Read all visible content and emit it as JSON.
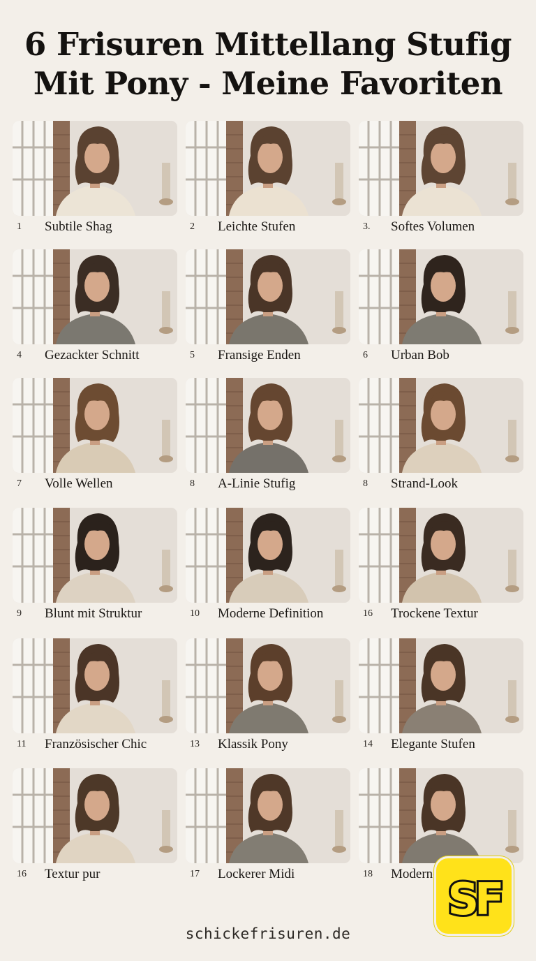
{
  "title": {
    "line1": "6 Frisuren Mittellang Stufig",
    "line2": "Mit Pony - Meine Favoriten"
  },
  "items": [
    {
      "number": "1",
      "label": "Subtile Shag",
      "top_color": "#ece4d6",
      "hair": "#5a4231"
    },
    {
      "number": "2",
      "label": "Leichte Stufen",
      "top_color": "#ebe1d1",
      "hair": "#5b4230"
    },
    {
      "number": "3.",
      "label": "Softes Volumen",
      "top_color": "#ebe2d3",
      "hair": "#5e4533"
    },
    {
      "number": "4",
      "label": "Gezackter Schnitt",
      "top_color": "#7b7870",
      "hair": "#3b2d24"
    },
    {
      "number": "5",
      "label": "Fransige Enden",
      "top_color": "#7a766d",
      "hair": "#4a3527"
    },
    {
      "number": "6",
      "label": "Urban Bob",
      "top_color": "#7e7b72",
      "hair": "#2f241d"
    },
    {
      "number": "7",
      "label": "Volle Wellen",
      "top_color": "#d9cbb5",
      "hair": "#6d4c32"
    },
    {
      "number": "8",
      "label": "A-Linie Stufig",
      "top_color": "#75716a",
      "hair": "#654630"
    },
    {
      "number": "8",
      "label": "Strand-Look",
      "top_color": "#ddd0bd",
      "hair": "#6b4a31"
    },
    {
      "number": "9",
      "label": "Blunt mit Struktur",
      "top_color": "#ddd2c2",
      "hair": "#2b221c"
    },
    {
      "number": "10",
      "label": "Moderne Definition",
      "top_color": "#d8ccba",
      "hair": "#2c231d"
    },
    {
      "number": "16",
      "label": "Trockene Textur",
      "top_color": "#d2c3ad",
      "hair": "#3a2b21"
    },
    {
      "number": "11",
      "label": "Französischer Chic",
      "top_color": "#e2d7c6",
      "hair": "#4b3527"
    },
    {
      "number": "13",
      "label": "Klassik Pony",
      "top_color": "#7f7a70",
      "hair": "#5c3f2b"
    },
    {
      "number": "14",
      "label": "Elegante Stufen",
      "top_color": "#8a8074",
      "hair": "#4a3526"
    },
    {
      "number": "16",
      "label": "Textur pur",
      "top_color": "#e0d4c2",
      "hair": "#4d3828"
    },
    {
      "number": "17",
      "label": "Lockerer Midi",
      "top_color": "#827d73",
      "hair": "#4f3828"
    },
    {
      "number": "18",
      "label": "Moderner Schnitt",
      "top_color": "#807a70",
      "hair": "#4a3526"
    }
  ],
  "footer": "schickefrisuren.de",
  "logo": {
    "text": "SF",
    "bg_color": "#ffe21a"
  }
}
